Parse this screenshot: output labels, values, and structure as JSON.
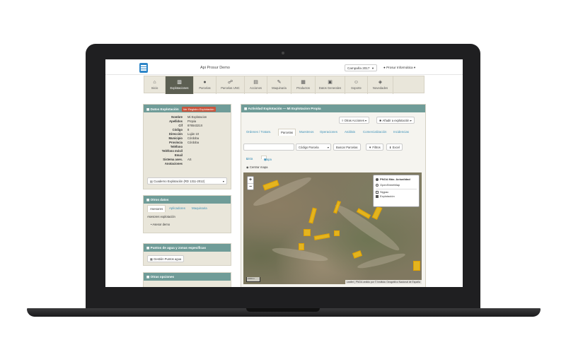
{
  "header": {
    "title": "Api Prosur Demo",
    "campaign": "Campaña 2017",
    "user": "Prosur Informática"
  },
  "nav": [
    {
      "label": "Inicio",
      "icon": "home-icon"
    },
    {
      "label": "Explotaciones",
      "icon": "columns-icon"
    },
    {
      "label": "Parcelas",
      "icon": "globe-icon"
    },
    {
      "label": "Parcelas UNC",
      "icon": "sitemap-icon"
    },
    {
      "label": "Acciones",
      "icon": "bar-chart-icon"
    },
    {
      "label": "Maquinaria",
      "icon": "wrench-icon"
    },
    {
      "label": "Productos",
      "icon": "barcode-icon"
    },
    {
      "label": "Datos Generales",
      "icon": "briefcase-icon"
    },
    {
      "label": "Soporte",
      "icon": "user-support-icon"
    },
    {
      "label": "Novedades",
      "icon": "tags-icon"
    }
  ],
  "datos": {
    "title": "Datos Explotación",
    "badge": "Ver Registro Explotación",
    "rows": [
      {
        "k": "Nombre",
        "v": "Mi Explotacion"
      },
      {
        "k": "Apellidos",
        "v": "Propia"
      },
      {
        "k": "Cif",
        "v": "87654321X"
      },
      {
        "k": "Código",
        "v": "8"
      },
      {
        "k": "Dirección",
        "v": "Luján 10"
      },
      {
        "k": "Municipio",
        "v": "Córdoba"
      },
      {
        "k": "Provincia",
        "v": "Córdoba"
      },
      {
        "k": "Teléfono",
        "v": ""
      },
      {
        "k": "Teléfono móvil",
        "v": ""
      },
      {
        "k": "Email",
        "v": ""
      },
      {
        "k": "Sistema ases.",
        "v": "AS"
      },
      {
        "k": "Anotaciones",
        "v": ""
      }
    ],
    "cuaderno": "Cuaderno Explotación (RD 1311-2012)"
  },
  "otros": {
    "title": "Otros datos",
    "tabs": [
      "Asesores",
      "Aplicadores",
      "Maquinaria"
    ],
    "subtitle": "Asesores explotación",
    "item": "Asesor demo"
  },
  "puntos": {
    "title": "Puntos de agua y zonas específicas",
    "button": "Gestión Puntos agua"
  },
  "opciones": {
    "title": "Otras opciones"
  },
  "actividad": {
    "title": "Actividad Explotación",
    "subtitle": "Mi Explotacion Propia",
    "actions": "Otras Acciones",
    "add": "Añadir a explotación",
    "tabs": [
      "Ordenes / Tratam.",
      "Parcelas",
      "Muestreos",
      "Operaciones",
      "Análisis",
      "Comercialización",
      "Incidencias"
    ],
    "search_select": "Código Parcela",
    "search_btn": "Buscar Parcelas",
    "filters_btn": "Filtros",
    "excel_btn": "Excel",
    "view_list": "Lista",
    "view_map": "Mapa",
    "center": "Centrar mapa"
  },
  "map": {
    "layers": [
      "PNOA Máx. Actualidad",
      "OpenStreetMap",
      "Sigpac",
      "Explotación"
    ],
    "attribution": "Leaflet | PNOA cedido por © Instituto Geográfico Nacional de España",
    "scale": "1000 m"
  }
}
